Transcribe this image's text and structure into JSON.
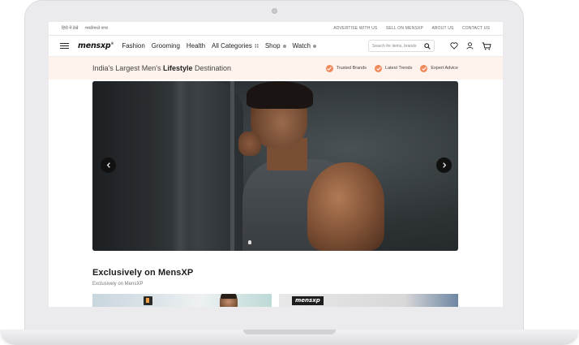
{
  "topbar": {
    "lang_hindi": "हिंदी में देखें",
    "lang_marathi": "मराठीमध्ये वाचा",
    "links": [
      "ADVERTISE WITH US",
      "SELL ON MENSXP",
      "ABOUT US",
      "CONTACT US"
    ]
  },
  "navbar": {
    "logo": "mensxp",
    "logo_mark": "®",
    "items": [
      "Fashion",
      "Grooming",
      "Health",
      "All Categories",
      "Shop",
      "Watch"
    ],
    "search_placeholder": "Search for items, brands"
  },
  "strip": {
    "tagline_pre": "India's Largest Men's ",
    "tagline_bold": "Lifestyle",
    "tagline_post": " Destination",
    "badges": [
      "Trusted Brands",
      "Latest Trends",
      "Expert Advice"
    ],
    "badge_color": "#f08a5a"
  },
  "hero": {
    "prev_icon": "chevron-left-icon",
    "next_icon": "chevron-right-icon"
  },
  "section": {
    "title": "Exclusively on MensXP",
    "subtitle": "Exclusively on MensXP"
  },
  "cards": {
    "second_logo": "mensxp"
  }
}
